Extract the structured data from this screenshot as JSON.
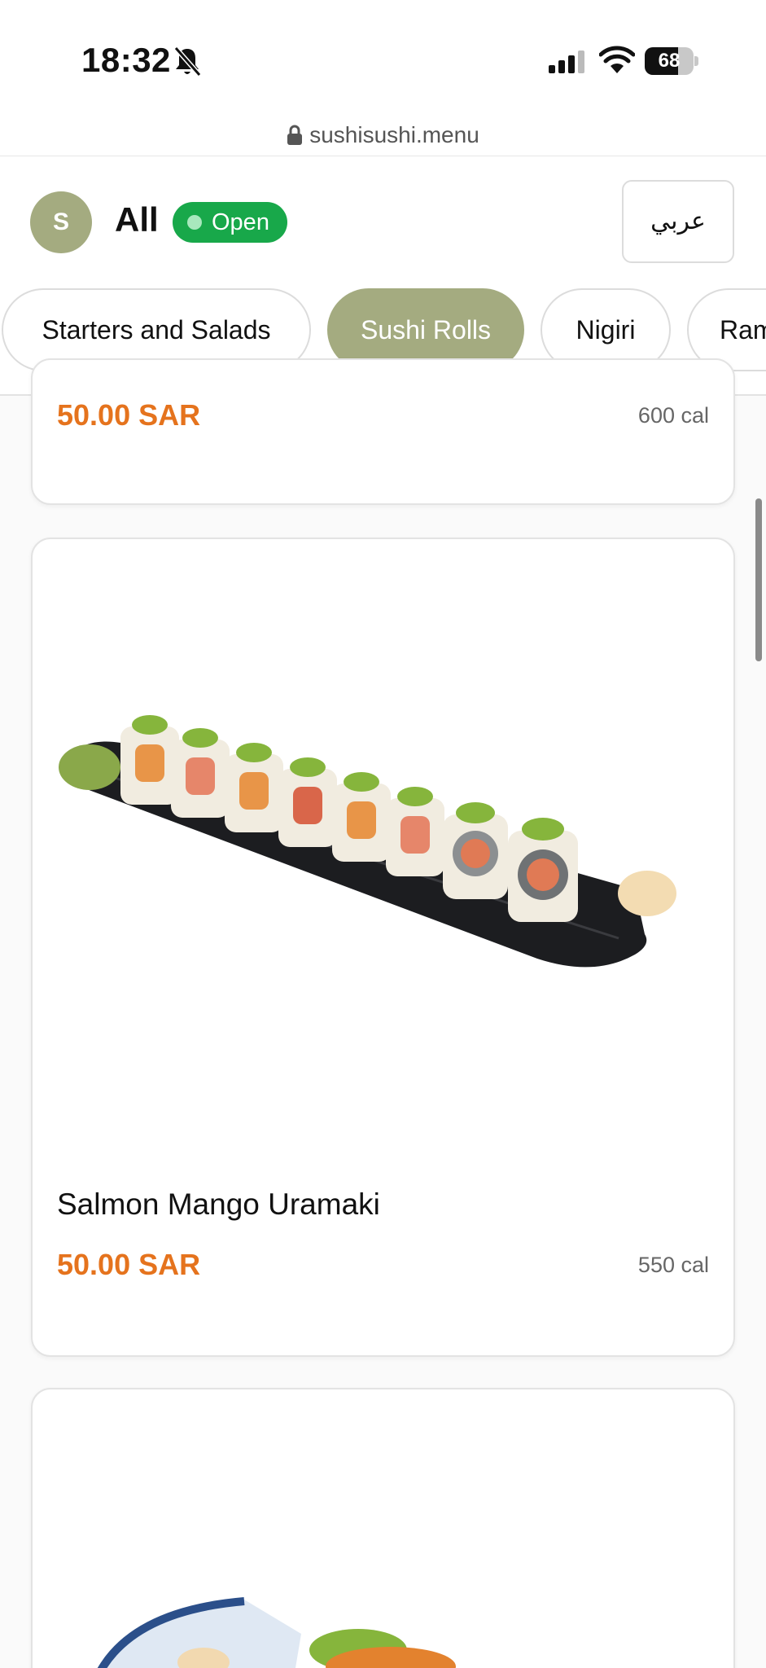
{
  "status_bar": {
    "time": "18:32",
    "battery": "68",
    "battery_level": 0.68
  },
  "browser": {
    "url": "sushisushi.menu"
  },
  "header": {
    "avatar_initial": "S",
    "store_name": "All",
    "status_label": "Open",
    "language_button": "عربي"
  },
  "categories": {
    "items": [
      "Starters and Salads",
      "Sushi Rolls",
      "Nigiri",
      "Ramen"
    ],
    "active": "Sushi Rolls"
  },
  "menu_items": [
    {
      "name": "",
      "price": "50.00 SAR",
      "calories": "600 cal"
    },
    {
      "name": "Salmon Mango Uramaki",
      "price": "50.00 SAR",
      "calories": "550 cal"
    },
    {
      "name": "",
      "price": "",
      "calories": ""
    }
  ],
  "colors": {
    "accent": "#a4ab80",
    "open_green": "#18a84a",
    "price_orange": "#e5731d"
  },
  "icons": [
    "bell-muted-icon",
    "signal-icon",
    "wifi-icon",
    "battery-icon",
    "lock-icon"
  ]
}
